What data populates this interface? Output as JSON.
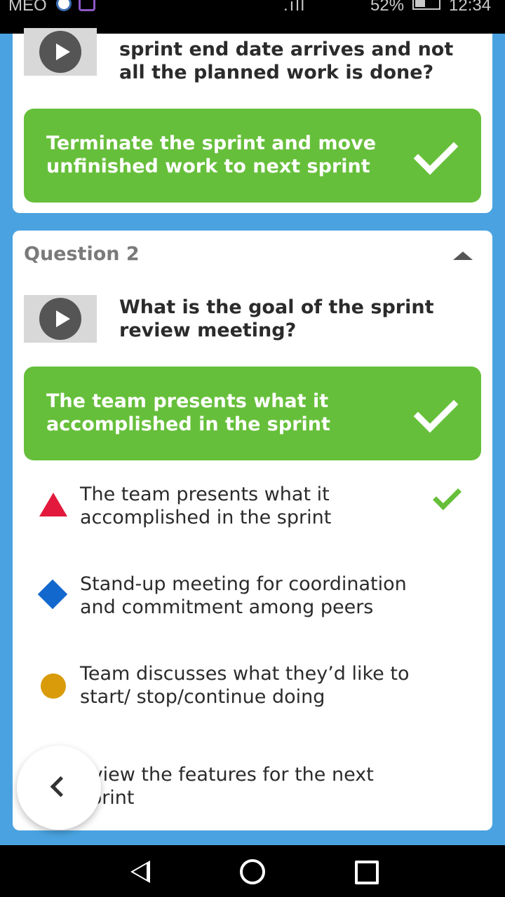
{
  "status_bar": {
    "carrier": "MEO",
    "signal": ".ıll",
    "battery": "52%",
    "time": "12:34"
  },
  "question1": {
    "text": "sprint end date arrives and not all the planned work is done?",
    "answer": "Terminate the sprint and move unfinished work to next sprint"
  },
  "question2": {
    "label": "Question 2",
    "text": "What is the goal of the sprint review meeting?",
    "answer": "The team presents what it accomplished in the sprint",
    "options": [
      {
        "text": "The team presents what it accomplished in the sprint",
        "shape": "triangle",
        "color": "#e2193c",
        "correct": true
      },
      {
        "text": "Stand-up meeting for coordination and commitment among peers",
        "shape": "diamond",
        "color": "#1368ce",
        "correct": false
      },
      {
        "text": "Team discusses what they’d like to start/ stop/continue doing",
        "shape": "circle",
        "color": "#d99b09",
        "correct": false
      },
      {
        "text": "eview the features for the next sprint",
        "shape": "square",
        "color": "#26890c",
        "correct": false
      }
    ]
  },
  "colors": {
    "background": "#4aa3e0",
    "correct_green": "#66bf3a"
  },
  "icons": {
    "play": "play-icon",
    "check": "check-icon",
    "collapse": "chevron-up-icon",
    "back": "chevron-left-icon"
  }
}
